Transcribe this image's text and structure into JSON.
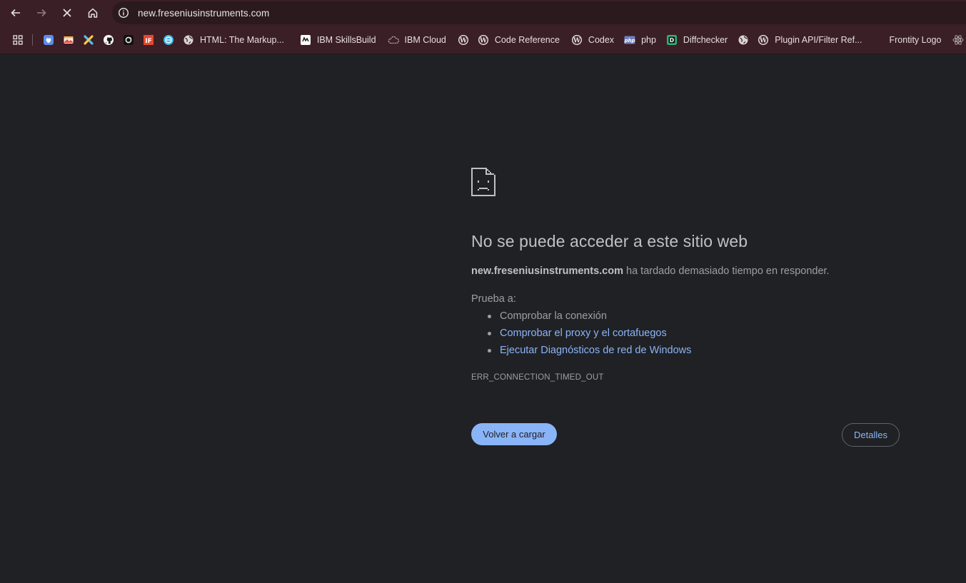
{
  "toolbar": {
    "back_icon": "arrow-left-icon",
    "forward_icon": "arrow-right-icon",
    "stop_icon": "close-icon",
    "home_icon": "home-icon",
    "site_info_icon": "info-circle-icon",
    "url": "new.freseniusinstruments.com"
  },
  "bookmarks": {
    "items": [
      {
        "icon": "apps-grid-icon",
        "label": ""
      },
      {
        "icon": "shield-heart-icon",
        "label": ""
      },
      {
        "icon": "photo-app-icon",
        "label": ""
      },
      {
        "icon": "cross-logo-icon",
        "label": ""
      },
      {
        "icon": "github-icon",
        "label": ""
      },
      {
        "icon": "dark-app-icon",
        "label": ""
      },
      {
        "icon": "if-logo-icon",
        "label": ""
      },
      {
        "icon": "codepen-icon",
        "label": ""
      },
      {
        "icon": "globe-icon",
        "label": "HTML: The Markup..."
      },
      {
        "icon": "ibm-skillsbuild-icon",
        "label": "IBM SkillsBuild"
      },
      {
        "icon": "ibm-cloud-icon",
        "label": "IBM Cloud"
      },
      {
        "icon": "wordpress-icon",
        "label": ""
      },
      {
        "icon": "wordpress-icon",
        "label": "Code Reference"
      },
      {
        "icon": "wordpress-icon",
        "label": "Codex"
      },
      {
        "icon": "php-icon",
        "label": "php"
      },
      {
        "icon": "diffchecker-icon",
        "label": "Diffchecker"
      },
      {
        "icon": "globe-icon",
        "label": ""
      },
      {
        "icon": "wordpress-icon",
        "label": "Plugin API/Filter Ref..."
      },
      {
        "icon": "none",
        "label": "Frontity Logo"
      },
      {
        "icon": "react-icon",
        "label": ""
      }
    ]
  },
  "error": {
    "icon": "sad-page-icon",
    "title": "No se puede acceder a este sitio web",
    "host": "new.freseniusinstruments.com",
    "description_rest": " ha tardado demasiado tiempo en responder.",
    "try_label": "Prueba a:",
    "suggestions": [
      "Comprobar la conexión",
      "Comprobar el proxy y el cortafuegos",
      "Ejecutar Diagnósticos de red de Windows"
    ],
    "code": "ERR_CONNECTION_TIMED_OUT",
    "reload_label": "Volver a cargar",
    "details_label": "Detalles"
  },
  "colors": {
    "page_bg": "#202124",
    "toolbar_bg": "#3b1f26",
    "link": "#8ab4f8",
    "primary_button": "#8ab4f8"
  }
}
